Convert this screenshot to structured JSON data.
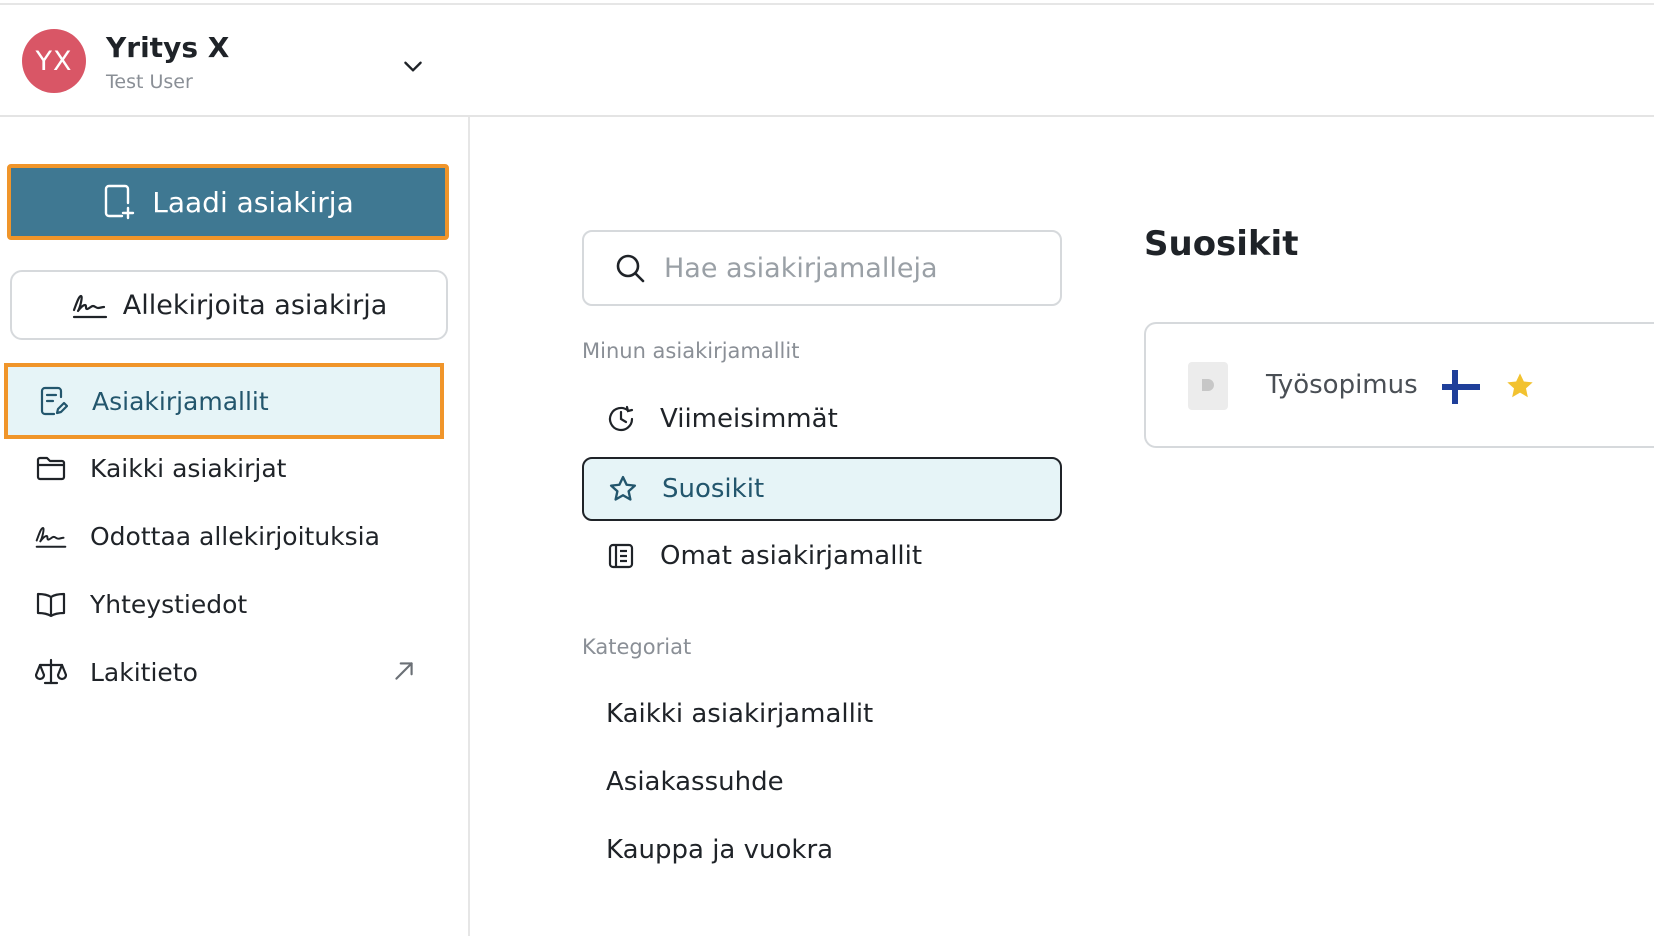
{
  "org": {
    "initials": "YX",
    "name": "Yritys X",
    "user": "Test User",
    "avatar_color": "#d95666"
  },
  "sidebar": {
    "compose_label": "Laadi asiakirja",
    "sign_label": "Allekirjoita asiakirja",
    "items": [
      {
        "label": "Asiakirjamallit",
        "icon": "document-edit-icon",
        "active": true
      },
      {
        "label": "Kaikki asiakirjat",
        "icon": "folder-icon"
      },
      {
        "label": "Odottaa allekirjoituksia",
        "icon": "signature-icon"
      },
      {
        "label": "Yhteystiedot",
        "icon": "book-icon"
      },
      {
        "label": "Lakitieto",
        "icon": "scales-icon",
        "external": true
      }
    ]
  },
  "templates": {
    "search_placeholder": "Hae asiakirjamalleja",
    "mine_heading": "Minun asiakirjamallit",
    "mine_items": [
      {
        "label": "Viimeisimmät",
        "icon": "clock-icon"
      },
      {
        "label": "Suosikit",
        "icon": "star-outline-icon",
        "selected": true
      },
      {
        "label": "Omat asiakirjamallit",
        "icon": "list-book-icon"
      }
    ],
    "categories_heading": "Kategoriat",
    "categories": [
      "Kaikki asiakirjamallit",
      "Asiakassuhde",
      "Kauppa ja vuokra"
    ]
  },
  "favorites": {
    "title": "Suosikit",
    "items": [
      {
        "name": "Työsopimus",
        "flag": "finland-flag-icon",
        "starred": true
      }
    ]
  },
  "colors": {
    "accent_primary": "#3f7892",
    "highlight_border": "#f0952a",
    "active_bg": "#e6f4f7",
    "star": "#f2c230",
    "flag_blue": "#1f3f9a"
  }
}
